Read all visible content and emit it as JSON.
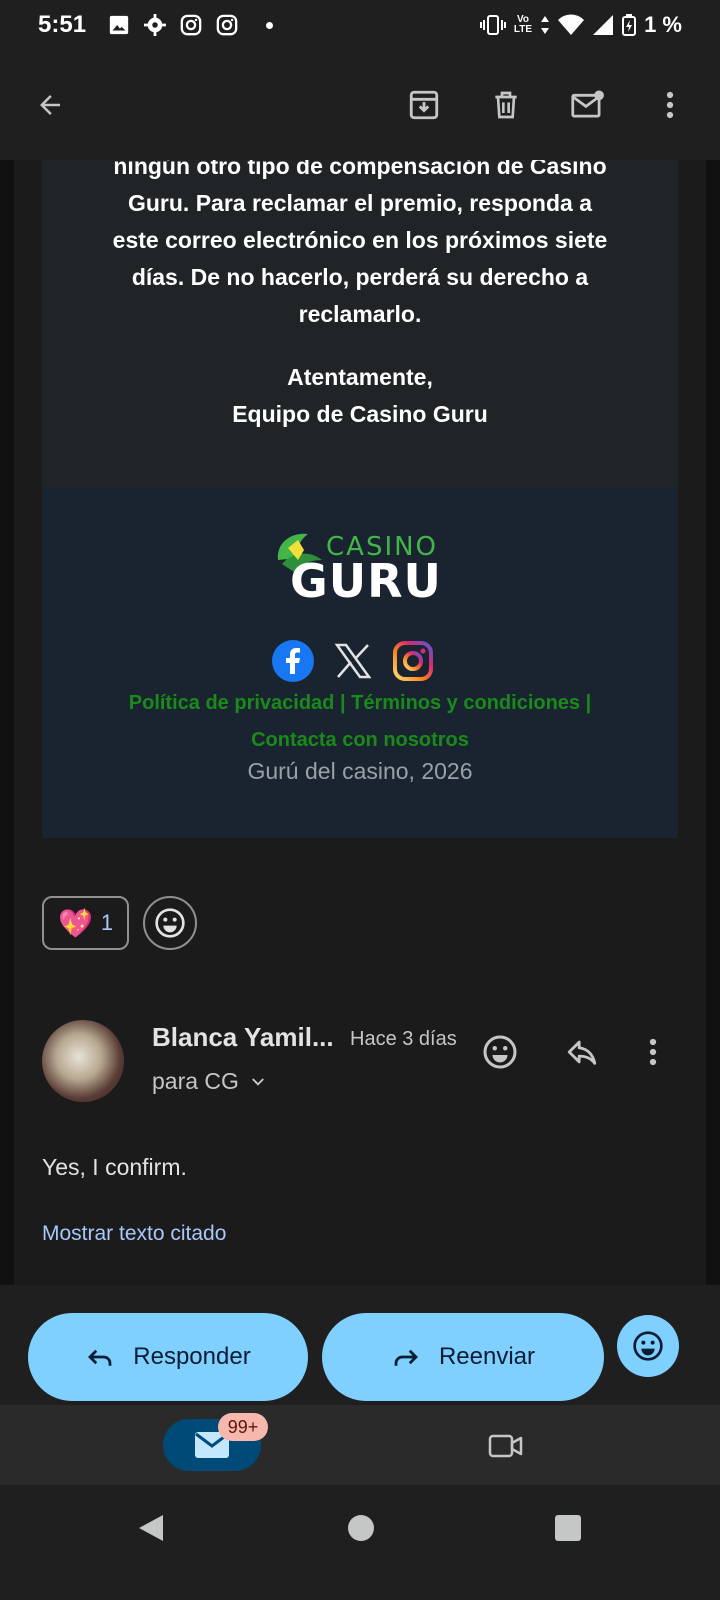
{
  "status_bar": {
    "time": "5:51",
    "battery": "1 %",
    "network_top": "Vo",
    "network_bottom": "LTE"
  },
  "appbar": {
    "back_icon": "arrow-left-icon",
    "actions": [
      "archive-icon",
      "trash-icon",
      "mark-unread-icon",
      "more-vert-icon"
    ]
  },
  "email": {
    "body_lines": [
      "ningún otro tipo de compensación de Casino",
      "Guru. Para reclamar el premio, responda a",
      "este correo electrónico en los próximos siete",
      "días. De no hacerlo, perderá su derecho a",
      "reclamarlo."
    ],
    "closing": "Atentamente,",
    "signature": "Equipo de Casino Guru",
    "logo_top": "CASINO",
    "logo_bottom": "GURU",
    "social_icons": [
      "facebook-icon",
      "x-icon",
      "instagram-icon"
    ],
    "link_privacy": "Política de privacidad",
    "link_terms": "Términos y condiciones",
    "link_contact": "Contacta con nosotros",
    "copyright": "Gurú del casino, 2026"
  },
  "reactions": {
    "emoji": "💖",
    "count": "1"
  },
  "reply_message": {
    "sender": "Blanca Yamil...",
    "time": "Hace 3 días",
    "recipient": "para CG",
    "text": "Yes, I confirm.",
    "show_quoted": "Mostrar texto citado"
  },
  "bottom_actions": {
    "reply_label": "Responder",
    "forward_label": "Reenviar"
  },
  "bottom_nav": {
    "mail_badge": "99+"
  },
  "colors": {
    "accent": "#7fcfff",
    "link_green": "#1a8a1a",
    "footer_bg": "#1a2430"
  }
}
